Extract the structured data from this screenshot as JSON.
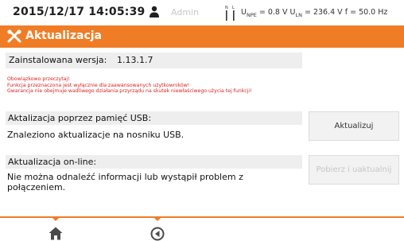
{
  "status": {
    "datetime": "2015/12/17 14:05:39",
    "user": "Admin",
    "measurements": {
      "u_npe": "0.8 V",
      "u_ln": "236.4 V",
      "f": "50.0 Hz"
    }
  },
  "header": {
    "title": "Aktualizacja"
  },
  "version": {
    "label": "Zainstalowana wersja:",
    "value": "1.13.1.7"
  },
  "warning": [
    "Obowiązkowo przeczytaj!",
    "Funkcja przeznaczona jest wyłącznie dla zaawansowanych użytkowników!",
    "Gwarancja nie obejmuje wadliwego działania przyrządu na skutek niewłaściwego użycia tej funkcji!"
  ],
  "usb": {
    "heading": "Aktalizacja poprzez pamięć USB:",
    "message": "Znaleziono aktualizacje na nosniku USB.",
    "button": "Aktualizuj"
  },
  "online": {
    "heading": "Aktualizacja on-line:",
    "message_line1": "Nie można odnaleźć informacji lub wystąpił problem z",
    "message_line2": "połączeniem.",
    "button": "Pobierz i uaktualnij"
  },
  "colors": {
    "accent": "#f07d26",
    "warning": "#e02020",
    "disabled": "#c6c6c6"
  },
  "icons": {
    "user": "user-icon",
    "plug": "plug-icon",
    "tool": "tool-icon",
    "home": "home-icon",
    "back": "back-icon"
  }
}
